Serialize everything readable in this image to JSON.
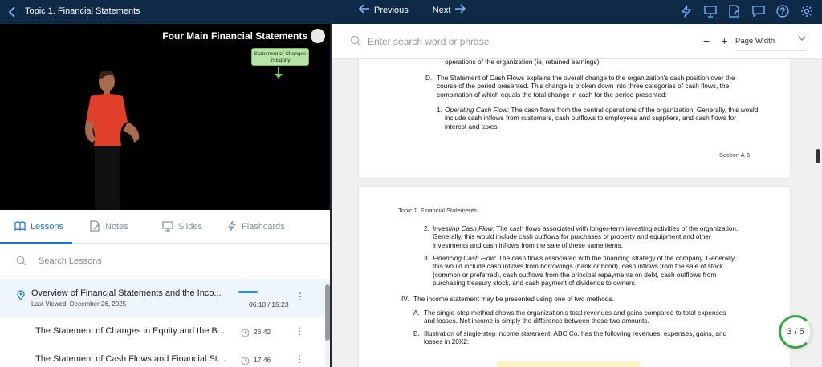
{
  "topbar": {
    "title": "Topic 1. Financial Statements",
    "previous_label": "Previous",
    "next_label": "Next",
    "icons": [
      "lightning-icon",
      "presentation-icon",
      "notes-icon",
      "comment-icon",
      "help-icon",
      "gear-icon"
    ]
  },
  "video": {
    "title": "Four Main Financial Statements",
    "callout": "Statement of Changes in Equity"
  },
  "tabs": [
    {
      "label": "Lessons",
      "icon": "book-icon",
      "active": true
    },
    {
      "label": "Notes",
      "icon": "notes-icon",
      "active": false
    },
    {
      "label": "Slides",
      "icon": "presentation-icon",
      "active": false
    },
    {
      "label": "Flashcards",
      "icon": "lightning-icon",
      "active": false
    }
  ],
  "lesson_search": {
    "placeholder": "Search Lessons"
  },
  "lessons": [
    {
      "name": "Overview of Financial Statements and the Inco...",
      "last_viewed": "Last Viewed: December 26, 2025",
      "time": "06:10 / 15:23",
      "progress": 0.4
    },
    {
      "name": "The Statement of Changes in Equity and the B...",
      "time": "26:42"
    },
    {
      "name": "The Statement of Cash Flows and Financial Sta...",
      "time": "17:46"
    }
  ],
  "doc_search": {
    "placeholder": "Enter search word or phrase"
  },
  "zoom": {
    "minus": "−",
    "plus": "+",
    "mode": "Page Width"
  },
  "page1": {
    "line0": "operations of the organization (ie, retained earnings).",
    "d_label": "D.",
    "d_text": "The Statement of Cash Flows explains the overall change to the organization's cash position over the course of the period presented. This change is broken down into three categories of cash flows, the combination of which equals the total change in cash for the period presented:",
    "i1_num": "1.",
    "i1_title": "Operating Cash Flow",
    "i1_text": ": The cash flows from the central operations of the organization. Generally, this would include cash inflows from customers, cash outflows to employees and suppliers, and cash flows for interest and taxes.",
    "footer": "Section A-5"
  },
  "page2": {
    "header": "Topic 1. Financial Statements",
    "i2_num": "2.",
    "i2_title": "Investing Cash Flow",
    "i2_text": ": The cash flows associated with longer-term investing activities of the organization. Generally, this would include cash outflows for purchases of property and equipment and other investments and cash inflows from the sale of these same items.",
    "i3_num": "3.",
    "i3_title": "Financing Cash Flow",
    "i3_text": ": The cash flows associated with the financing strategy of the company. Generally, this would include cash inflows from borrowings (bank or bond), cash inflows from the sale of stock (common or preferred), cash outflows from the principal repayments on debt, cash outflows from purchasing treasury stock, and cash payment of dividends to owners.",
    "iv_num": "IV.",
    "iv_text": "The income statement may be presented using one of two methods.",
    "a_num": "A.",
    "a_text": "The single-step method shows the organization's total revenues and gains compared to total expenses and losses. Net income is simply the difference between these two amounts.",
    "b_num": "B.",
    "b_text": "Illustration of single-step income statement: ABC Co. has the following revenues, expenses, gains, and losses in 20X2:"
  },
  "page_badge": "3 / 5",
  "colors": {
    "topbar": "#0e2a47",
    "accent": "#1a73c8",
    "progress": "#3aa64a"
  }
}
